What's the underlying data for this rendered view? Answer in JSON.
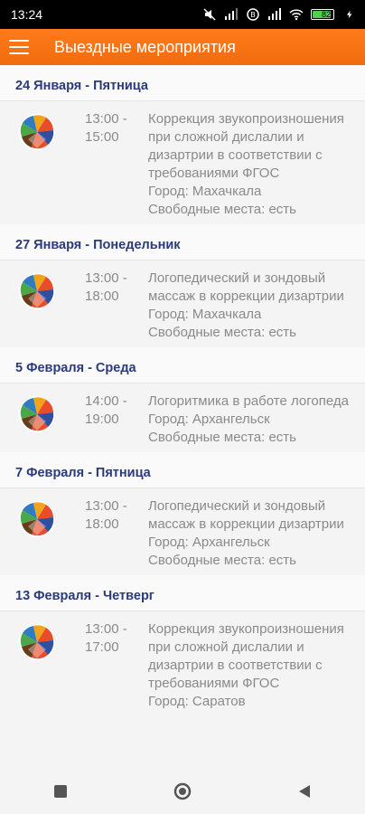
{
  "status_bar": {
    "time": "13:24",
    "battery_level": "82"
  },
  "app_bar": {
    "title": "Выездные мероприятия"
  },
  "events": [
    {
      "date": "24 Января - Пятница",
      "start": "13:00 -",
      "end": "15:00",
      "title": "Коррекция звукопроизношения при сложной дислалии и дизартрии в соответствии с требованиями ФГОС",
      "city": "Город: Махачкала",
      "seats": "Свободные места: есть"
    },
    {
      "date": "27 Января - Понедельник",
      "start": "13:00 -",
      "end": "18:00",
      "title": "Логопедический и зондовый массаж в коррекции дизартрии",
      "city": "Город: Махачкала",
      "seats": "Свободные места: есть"
    },
    {
      "date": "5 Февраля - Среда",
      "start": "14:00 -",
      "end": "19:00",
      "title": "Логоритмика в работе логопеда",
      "city": "Город: Архангельск",
      "seats": "Свободные места: есть"
    },
    {
      "date": "7 Февраля - Пятница",
      "start": "13:00 -",
      "end": "18:00",
      "title": "Логопедический и зондовый массаж в коррекции дизартрии",
      "city": "Город: Архангельск",
      "seats": "Свободные места: есть"
    },
    {
      "date": "13 Февраля - Четверг",
      "start": "13:00 -",
      "end": "17:00",
      "title": "Коррекция звукопроизношения при сложной дислалии и дизартрии в соответствии с требованиями ФГОС",
      "city": "Город: Саратов",
      "seats": ""
    }
  ],
  "colors": {
    "accent": "#f27011",
    "date_header": "#2a3a7a",
    "text_secondary": "#8a8a8a"
  },
  "icons": {
    "menu": "hamburger-icon",
    "logo": "org-logo-icon",
    "nav_recent": "square-icon",
    "nav_home": "circle-icon",
    "nav_back": "triangle-back-icon"
  }
}
